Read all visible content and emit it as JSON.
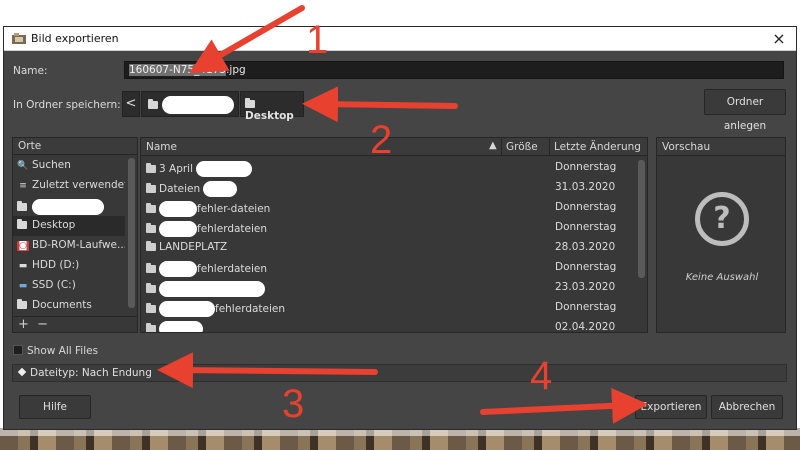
{
  "dialog": {
    "title": "Bild exportieren",
    "close_glyph": "×"
  },
  "name": {
    "label": "Name:",
    "value_selected": "160607-N75_4173",
    "value_ext": ".jpg"
  },
  "folder": {
    "label": "In Ordner speichern:",
    "back_glyph": "<",
    "crumb_current": "Desktop",
    "create_button": "Ordner anlegen"
  },
  "places": {
    "header": "Orte",
    "items": [
      {
        "icon": "search-icon",
        "glyph": "🔍",
        "label": "Suchen"
      },
      {
        "icon": "recent-icon",
        "glyph": "≡",
        "label": "Zuletzt verwendet"
      },
      {
        "icon": "home-folder-icon",
        "glyph": "",
        "label": ""
      },
      {
        "icon": "folder-icon",
        "glyph": "",
        "label": "Desktop"
      },
      {
        "icon": "disc-icon",
        "glyph": "◙",
        "label": "BD-ROM-Laufwe..."
      },
      {
        "icon": "drive-icon",
        "glyph": "▬",
        "label": "HDD (D:)"
      },
      {
        "icon": "drive-icon",
        "glyph": "▬",
        "label": "SSD (C:)"
      },
      {
        "icon": "folder-icon",
        "glyph": "",
        "label": "Documents"
      }
    ],
    "add_glyph": "+",
    "remove_glyph": "−"
  },
  "files": {
    "columns": {
      "name": "Name",
      "size": "Größe",
      "modified": "Letzte Änderung"
    },
    "rows": [
      {
        "name": "3 April",
        "date": "Donnerstag"
      },
      {
        "name": "Dateien",
        "date": "31.03.2020"
      },
      {
        "name": "fehler-dateien",
        "date": "Donnerstag"
      },
      {
        "name": "fehlerdateien",
        "date": "Donnerstag"
      },
      {
        "name": "LANDEPLATZ",
        "date": "28.03.2020"
      },
      {
        "name": "fehlerdateien",
        "date": "Donnerstag"
      },
      {
        "name": "",
        "date": "23.03.2020"
      },
      {
        "name": "fehlerdateien",
        "date": "Donnerstag"
      },
      {
        "name": "",
        "date": "02.04.2020"
      }
    ]
  },
  "preview": {
    "header": "Vorschau",
    "glyph": "?",
    "empty_text": "Keine Auswahl"
  },
  "options": {
    "show_all_files": "Show All Files",
    "filetype": "Dateityp: Nach Endung"
  },
  "buttons": {
    "help": "Hilfe",
    "export": "Exportieren",
    "cancel": "Abbrechen"
  },
  "annotations": {
    "n1": "1",
    "n2": "2",
    "n3": "3",
    "n4": "4",
    "color": "#e8412f"
  }
}
